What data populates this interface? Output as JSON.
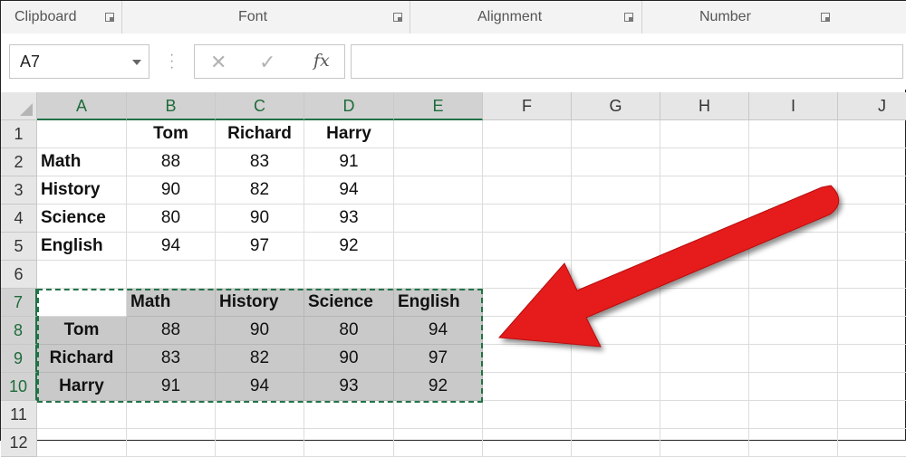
{
  "ribbon": {
    "groups": [
      {
        "label": "Clipboard"
      },
      {
        "label": "Font"
      },
      {
        "label": "Alignment"
      },
      {
        "label": "Number"
      }
    ]
  },
  "formula_bar": {
    "name_box": "A7",
    "cancel_icon": "✕",
    "enter_icon": "✓",
    "fx_label": "fx",
    "formula": ""
  },
  "columns": [
    "A",
    "B",
    "C",
    "D",
    "E",
    "F",
    "G",
    "H",
    "I",
    "J"
  ],
  "rows": [
    "1",
    "2",
    "3",
    "4",
    "5",
    "6",
    "7",
    "8",
    "9",
    "10",
    "11",
    "12"
  ],
  "cells": {
    "r1": [
      "",
      "Tom",
      "Richard",
      "Harry"
    ],
    "r2": [
      "Math",
      "88",
      "83",
      "91"
    ],
    "r3": [
      "History",
      "90",
      "82",
      "94"
    ],
    "r4": [
      "Science",
      "80",
      "90",
      "93"
    ],
    "r5": [
      "English",
      "94",
      "97",
      "92"
    ],
    "r7": [
      "",
      "Math",
      "History",
      "Science",
      "English"
    ],
    "r8": [
      "Tom",
      "88",
      "90",
      "80",
      "94"
    ],
    "r9": [
      "Richard",
      "83",
      "82",
      "90",
      "97"
    ],
    "r10": [
      "Harry",
      "91",
      "94",
      "93",
      "92"
    ]
  },
  "colors": {
    "accent": "#217346",
    "arrow": "#e61a1a",
    "selection_fill": "#c9c9c9"
  }
}
